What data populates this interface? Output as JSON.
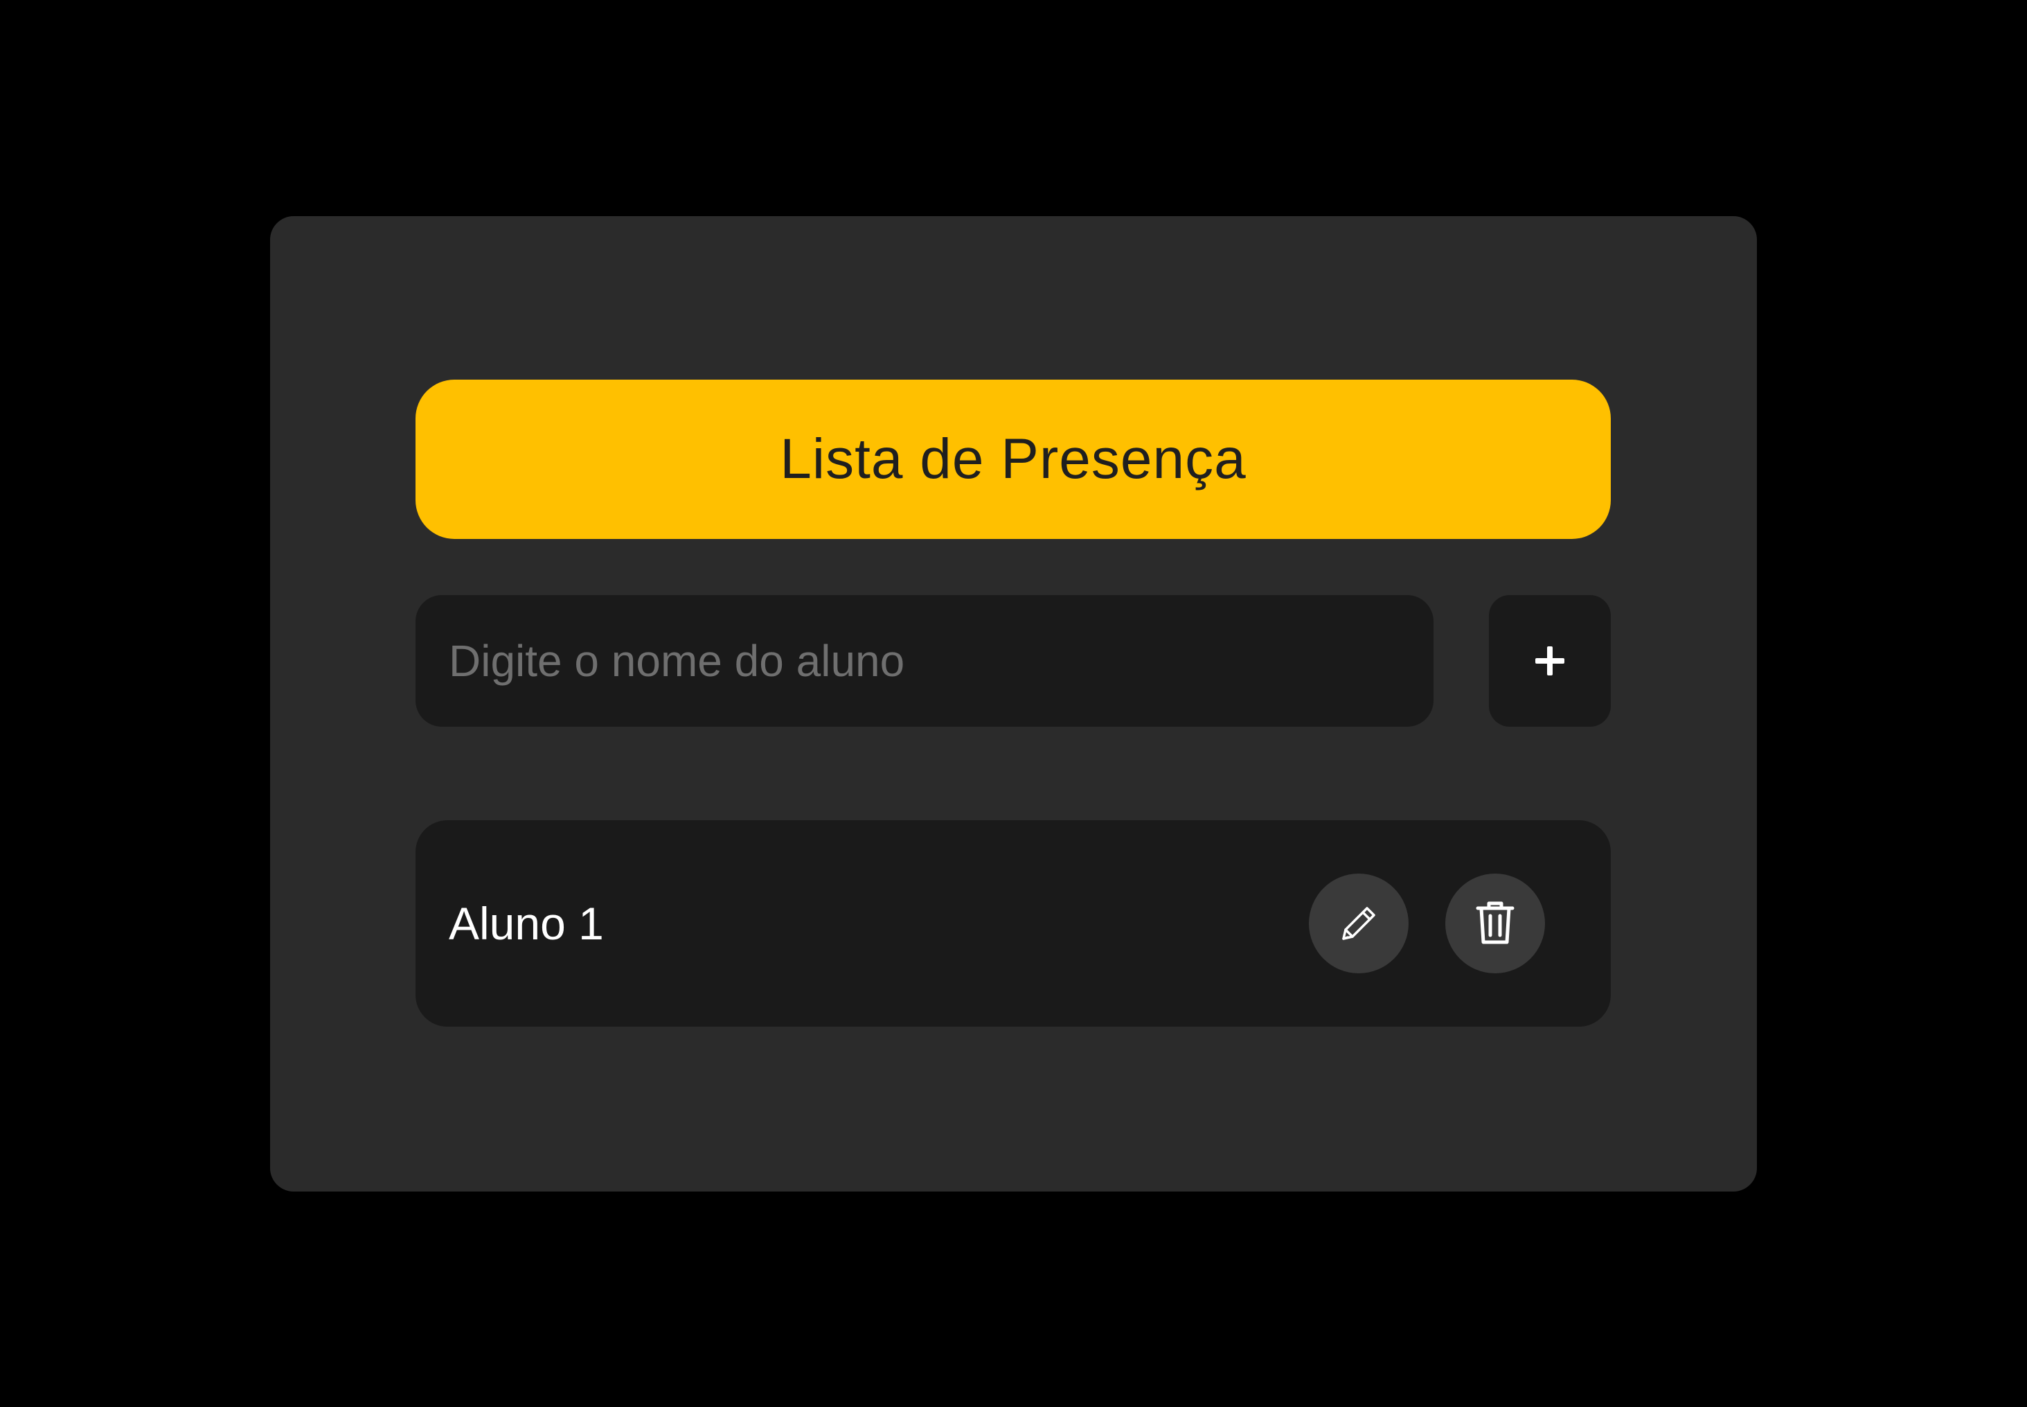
{
  "header": {
    "title": "Lista de Presença"
  },
  "form": {
    "input_placeholder": "Digite o nome do aluno",
    "input_value": "",
    "add_label": "+"
  },
  "students": [
    {
      "name": "Aluno 1"
    }
  ],
  "icons": {
    "add": "plus-icon",
    "edit": "pencil-icon",
    "delete": "trash-icon"
  },
  "colors": {
    "page_background": "#000000",
    "card_background": "#2b2b2b",
    "accent": "#ffc000",
    "field_background": "#1a1a1a",
    "action_button": "#3a3a3a"
  }
}
